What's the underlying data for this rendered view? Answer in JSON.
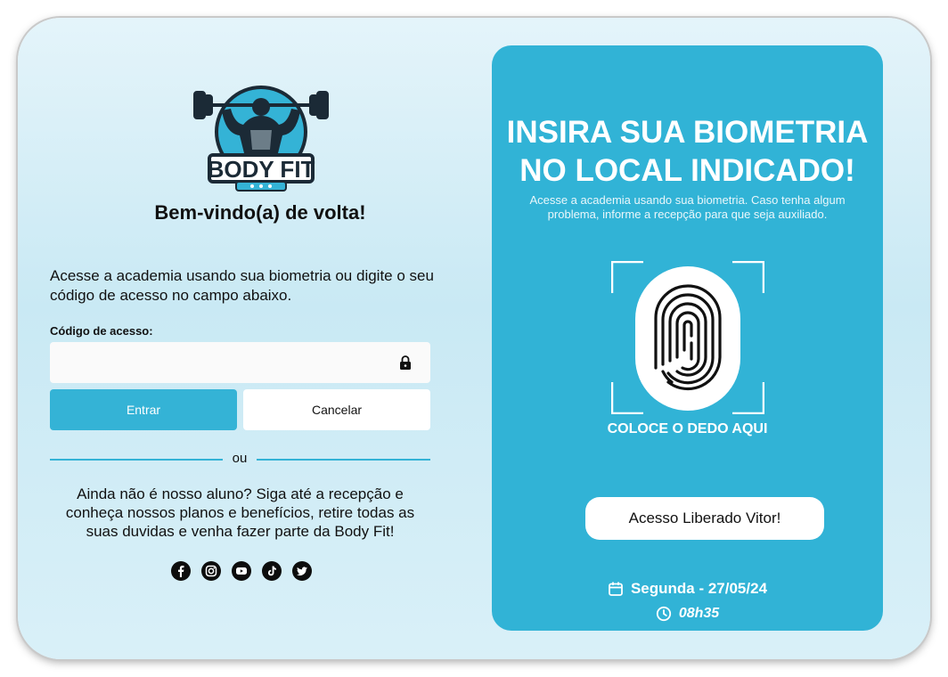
{
  "colors": {
    "accent": "#34b3d6",
    "panel": "#31b3d6",
    "text": "#111111",
    "surface": "#ffffff",
    "logo_dark": "#1b2a36"
  },
  "login": {
    "brand": "BODY FIT",
    "welcome": "Bem-vindo(a) de volta!",
    "intro": "Acesse a academia usando sua biometria ou digite o seu código de acesso no campo abaixo.",
    "code_label": "Código de acesso:",
    "code_value": "",
    "enter_label": "Entrar",
    "cancel_label": "Cancelar",
    "divider_text": "ou",
    "notice": "Ainda não é nosso aluno? Siga até a recepção e conheça nossos planos e benefícios, retire todas as suas duvidas e venha fazer parte da Body Fit!",
    "social_icons": [
      "facebook-icon",
      "instagram-icon",
      "youtube-icon",
      "tiktok-icon",
      "twitter-icon"
    ]
  },
  "biometric": {
    "title": "INSIRA SUA BIOMETRIA NO LOCAL INDICADO!",
    "subtitle": "Acesse a academia usando sua biometria. Caso tenha algum problema, informe a recepção para que seja auxiliado.",
    "place_finger": "COLOCE O DEDO AQUI",
    "status": "Acesso Liberado Vitor!",
    "date": "Segunda - 27/05/24",
    "time": "08h35",
    "icons": [
      "fingerprint-icon",
      "calendar-icon",
      "clock-icon"
    ]
  }
}
